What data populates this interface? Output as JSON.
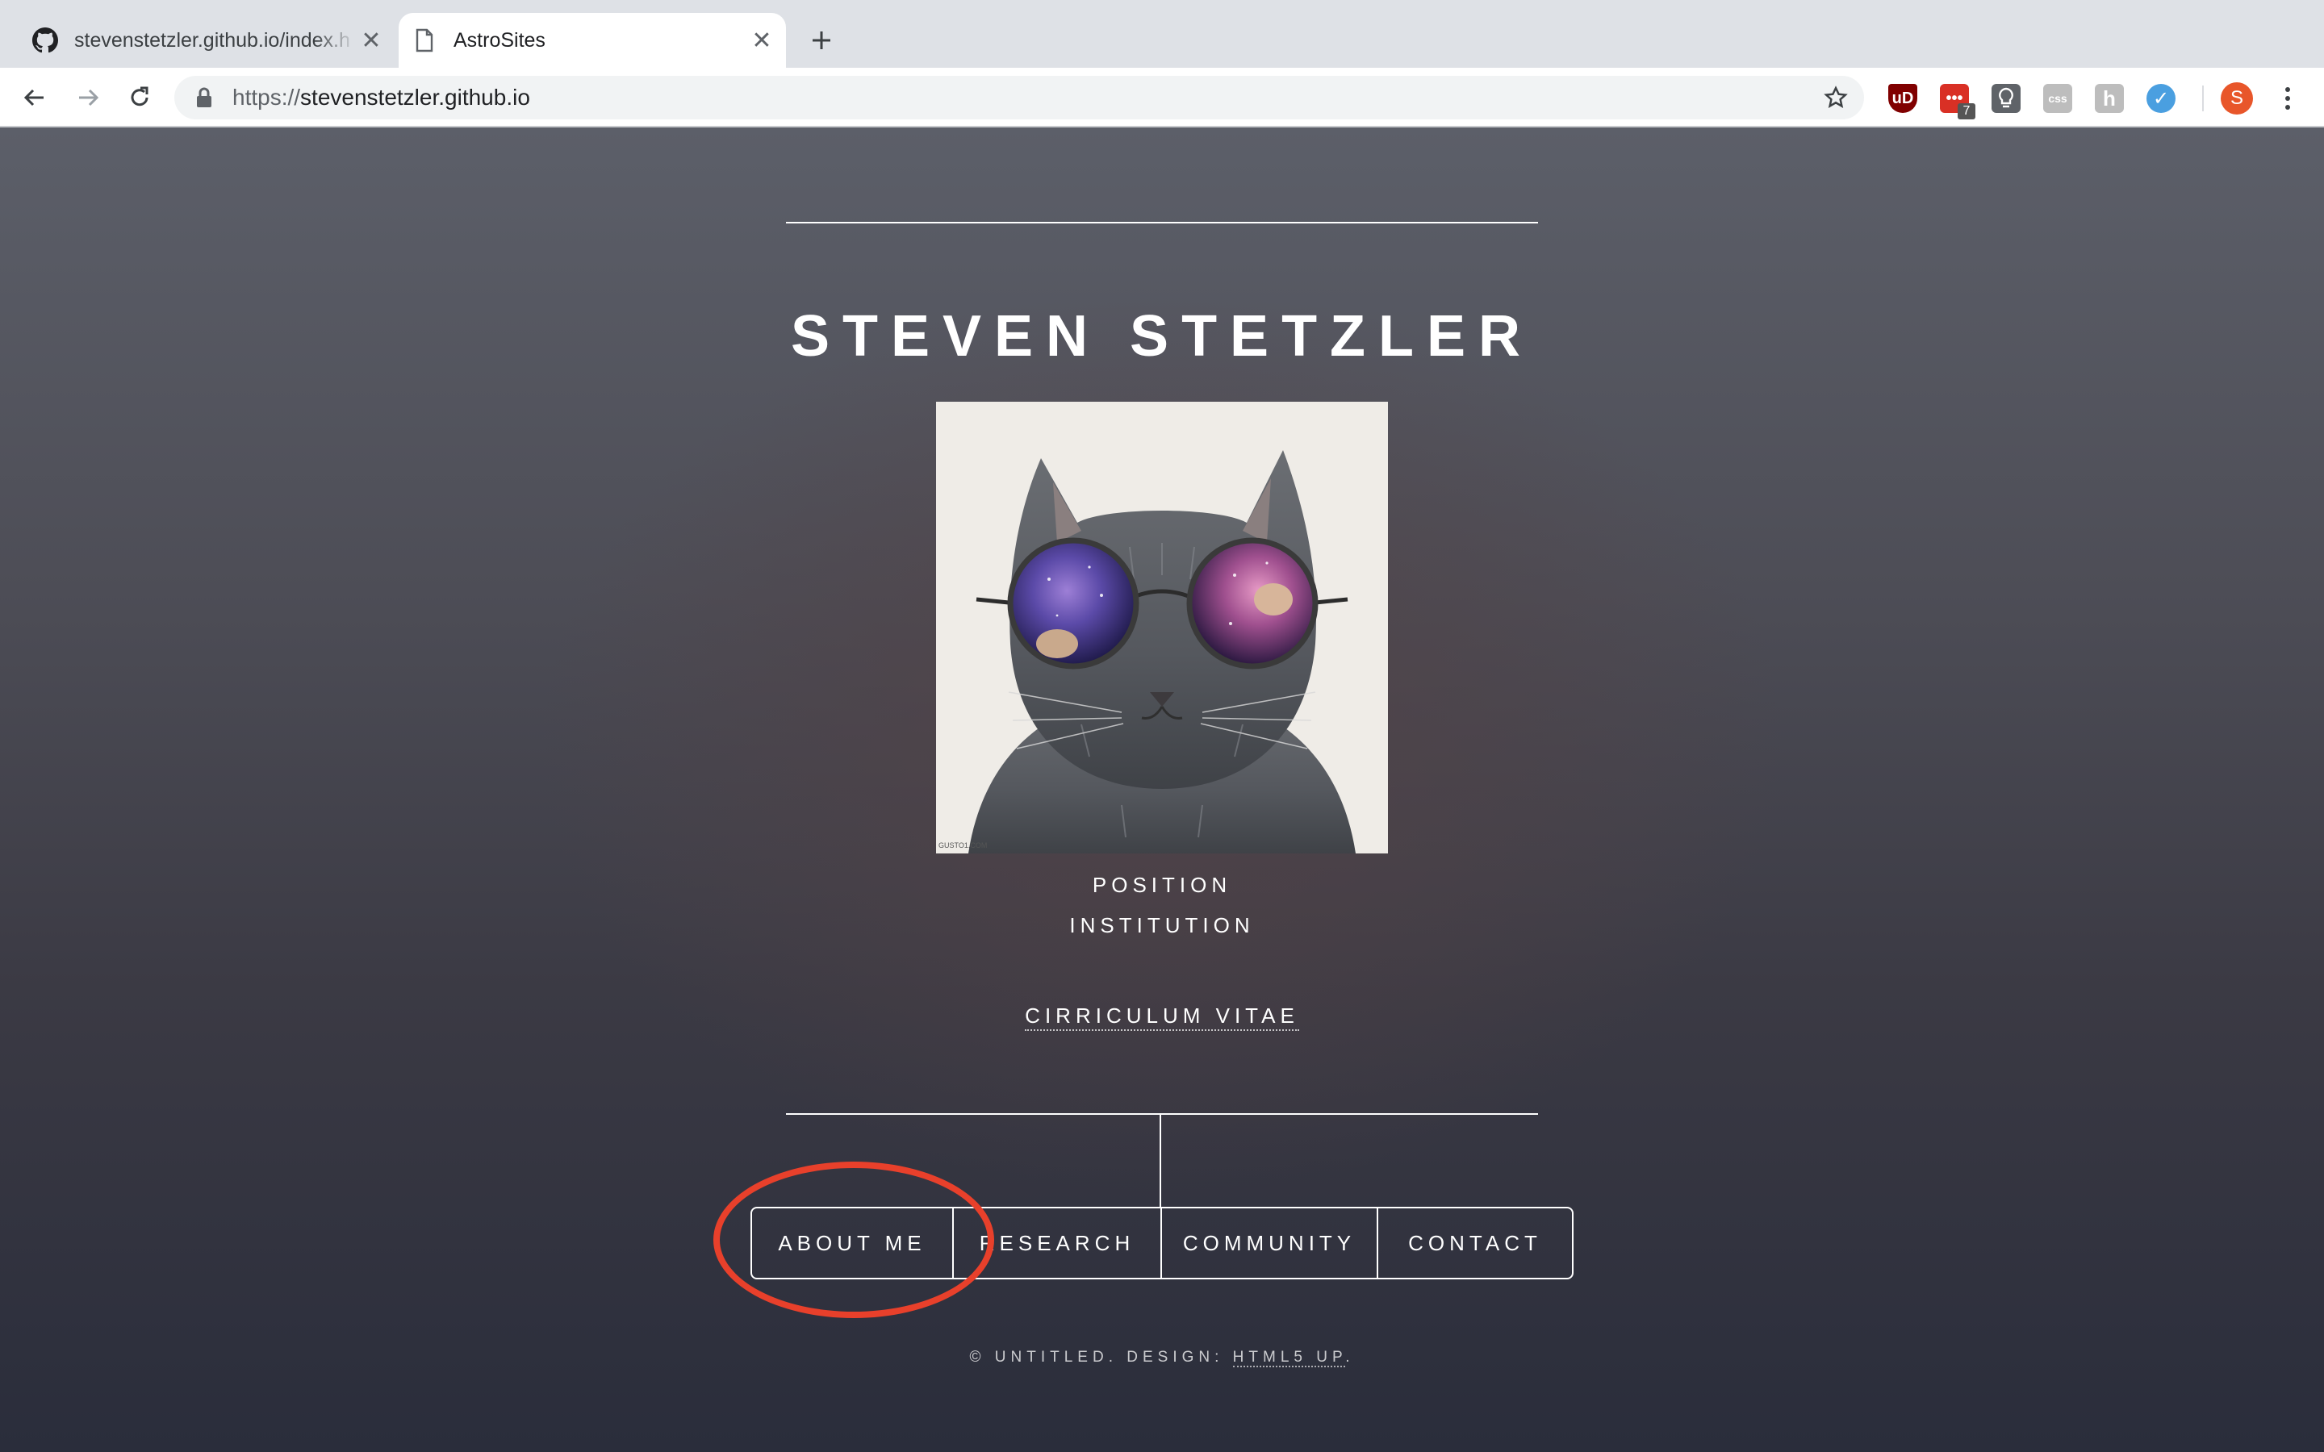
{
  "browser": {
    "tabs": [
      {
        "title": "stevenstetzler.github.io/index.h",
        "favicon": "github-icon",
        "active": false
      },
      {
        "title": "AstroSites",
        "favicon": "page-icon",
        "active": true
      }
    ],
    "url_scheme": "https://",
    "url_host": "stevenstetzler.github.io",
    "extensions": [
      {
        "name": "ublock-icon",
        "label": "uD",
        "color": "#800000"
      },
      {
        "name": "todo-extension-icon",
        "label": "•••",
        "color": "#d93025",
        "badge": "7"
      },
      {
        "name": "lightbulb-icon",
        "label": "",
        "color": "#5f6368"
      },
      {
        "name": "css-extension-icon",
        "label": "css",
        "color": "#bdbdbd"
      },
      {
        "name": "hypothesis-icon",
        "label": "h",
        "color": "#bdbdbd"
      },
      {
        "name": "check-extension-icon",
        "label": "✓",
        "color": "#4a9fe0"
      }
    ],
    "profile_initial": "S",
    "profile_color": "#e8562a"
  },
  "page": {
    "title": "STEVEN STETZLER",
    "position": "POSITION",
    "institution": "INSTITUTION",
    "cv_link": "CIRRICULUM VITAE",
    "nav": [
      "ABOUT ME",
      "RESEARCH",
      "COMMUNITY",
      "CONTACT"
    ],
    "footer_prefix": "© UNTITLED. DESIGN: ",
    "footer_link": "HTML5 UP",
    "footer_suffix": ".",
    "image_watermark": "GUSTO1.COM",
    "highlight_color": "#e8402b"
  }
}
